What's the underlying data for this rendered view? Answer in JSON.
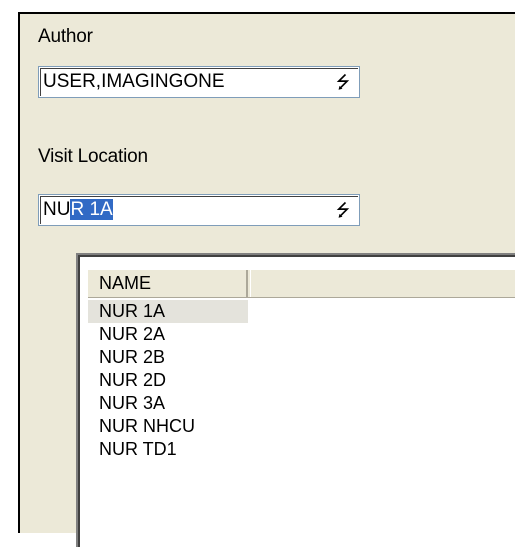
{
  "author": {
    "label": "Author",
    "value": "USER,IMAGINGONE",
    "dropdown_icon": "dropdown-arrow-icon"
  },
  "visit_location": {
    "label": "Visit Location",
    "typed_prefix": "NU",
    "selected_suffix": "R 1A",
    "dropdown_icon": "dropdown-arrow-icon"
  },
  "list": {
    "columns": [
      "NAME",
      ""
    ],
    "items": [
      "NUR 1A",
      "NUR 2A",
      "NUR 2B",
      "NUR 2D",
      "NUR 3A",
      "NUR NHCU",
      "NUR TD1"
    ],
    "selected_index": 0
  },
  "colors": {
    "panel_bg": "#ece9d8",
    "selection": "#316ac5"
  }
}
